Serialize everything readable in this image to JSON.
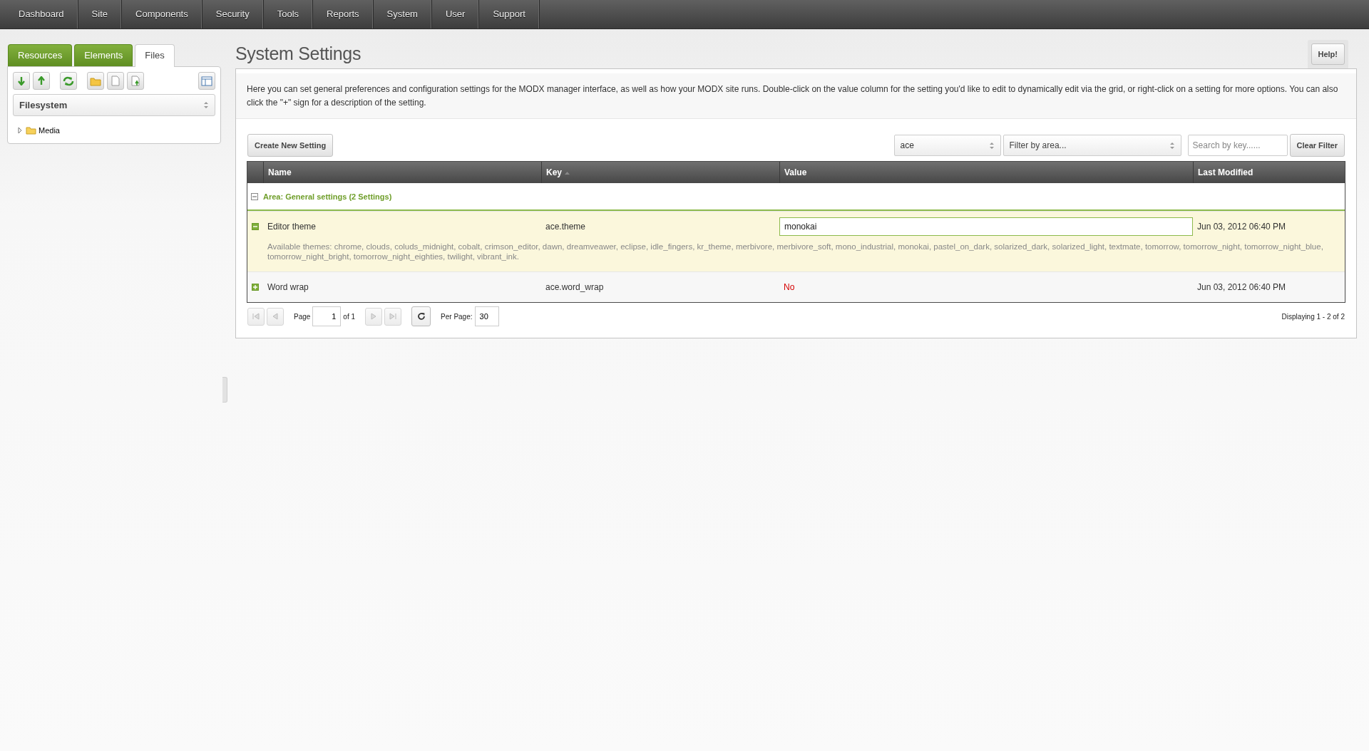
{
  "nav": [
    {
      "label": "Dashboard"
    },
    {
      "label": "Site"
    },
    {
      "label": "Components"
    },
    {
      "label": "Security"
    },
    {
      "label": "Tools"
    },
    {
      "label": "Reports"
    },
    {
      "label": "System"
    },
    {
      "label": "User"
    },
    {
      "label": "Support"
    }
  ],
  "sidebar": {
    "tabs": [
      {
        "label": "Resources",
        "selected": false
      },
      {
        "label": "Elements",
        "selected": false
      },
      {
        "label": "Files",
        "selected": true
      }
    ],
    "source": "Filesystem",
    "tree": [
      {
        "label": "Media",
        "expanded": false
      }
    ]
  },
  "page": {
    "title": "System Settings",
    "help": "Help!",
    "description": "Here you can set general preferences and configuration settings for the MODX manager interface, as well as how your MODX site runs. Double-click on the value column for the setting you'd like to edit to dynamically edit via the grid, or right-click on a setting for more options. You can also click the \"+\" sign for a description of the setting.",
    "create_button": "Create New Setting",
    "namespace_filter": "ace",
    "area_filter": {
      "placeholder": "Filter by area..."
    },
    "search": {
      "placeholder": "Search by key......"
    },
    "clear_button": "Clear Filter"
  },
  "grid": {
    "columns": [
      {
        "label": "Name",
        "sorted": false
      },
      {
        "label": "Key",
        "sorted": true
      },
      {
        "label": "Value",
        "sorted": false
      },
      {
        "label": "Last Modified",
        "sorted": false
      }
    ],
    "groups": [
      {
        "label": "Area: General settings (2 Settings)",
        "expanded": true,
        "rows": [
          {
            "name": "Editor theme",
            "key": "ace.theme",
            "value": "monokai",
            "kind": "text",
            "editing": true,
            "selected": true,
            "expanded": true,
            "description": "Available themes: chrome, clouds, coluds_midnight, cobalt, crimson_editor, dawn, dreamveawer, eclipse, idle_fingers, kr_theme, merbivore, merbivore_soft, mono_industrial, monokai, pastel_on_dark, solarized_dark, solarized_light, textmate, tomorrow, tomorrow_night, tomorrow_night_blue, tomorrow_night_bright, tomorrow_night_eighties, twilight, vibrant_ink.",
            "modified": "Jun 03, 2012 06:40 PM"
          },
          {
            "name": "Word wrap",
            "key": "ace.word_wrap",
            "value": "No",
            "kind": "boolean_no",
            "editing": false,
            "selected": false,
            "expanded": false,
            "modified": "Jun 03, 2012 06:40 PM"
          }
        ]
      }
    ]
  },
  "pager": {
    "page_label": "Page",
    "page": "1",
    "of": "of 1",
    "per_page_label": "Per Page:",
    "per_page": "30",
    "display": "Displaying 1 - 2 of 2"
  }
}
